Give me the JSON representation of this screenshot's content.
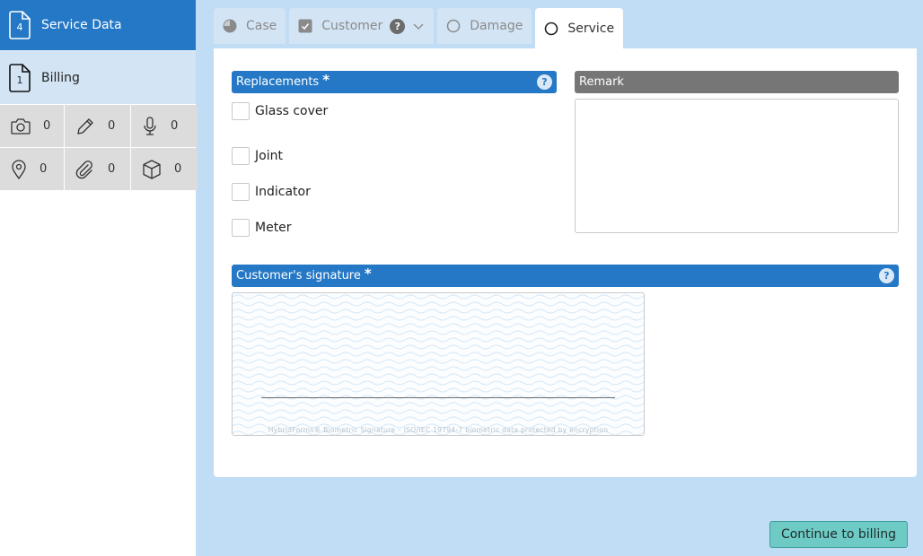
{
  "sidebar": {
    "items": [
      {
        "label": "Service Data",
        "count": "4",
        "active": true
      },
      {
        "label": "Billing",
        "count": "1",
        "active": false
      }
    ],
    "counters": [
      {
        "icon": "camera-icon",
        "count": "0"
      },
      {
        "icon": "pencil-icon",
        "count": "0"
      },
      {
        "icon": "microphone-icon",
        "count": "0"
      },
      {
        "icon": "location-pin-icon",
        "count": "0"
      },
      {
        "icon": "paperclip-icon",
        "count": "0"
      },
      {
        "icon": "cube-icon",
        "count": "0"
      }
    ]
  },
  "tabs": [
    {
      "label": "Case",
      "icon": "half-circle-icon",
      "active": false
    },
    {
      "label": "Customer",
      "icon": "checked-box-icon",
      "help": "?",
      "active": false
    },
    {
      "label": "Damage",
      "icon": "empty-circle-icon",
      "active": false
    },
    {
      "label": "Service",
      "icon": "empty-circle-icon",
      "active": true
    }
  ],
  "replacements": {
    "title": "Replacements",
    "required_mark": "*",
    "help": "?",
    "options": [
      {
        "label": "Glass cover",
        "checked": false
      },
      {
        "label": "Joint",
        "checked": false
      },
      {
        "label": "Indicator",
        "checked": false
      },
      {
        "label": "Meter",
        "checked": false
      }
    ]
  },
  "remark": {
    "title": "Remark",
    "value": ""
  },
  "signature": {
    "title": "Customer's signature",
    "required_mark": "*",
    "help": "?",
    "caption": "HybridForms® Biometric Signature  –  ISO/IEC 19794-7 biometric data protected by encryption"
  },
  "actions": {
    "continue_label": "Continue to billing"
  },
  "colors": {
    "primary": "#2578c5",
    "background": "#c1dcf5",
    "button": "#6ecac4"
  }
}
